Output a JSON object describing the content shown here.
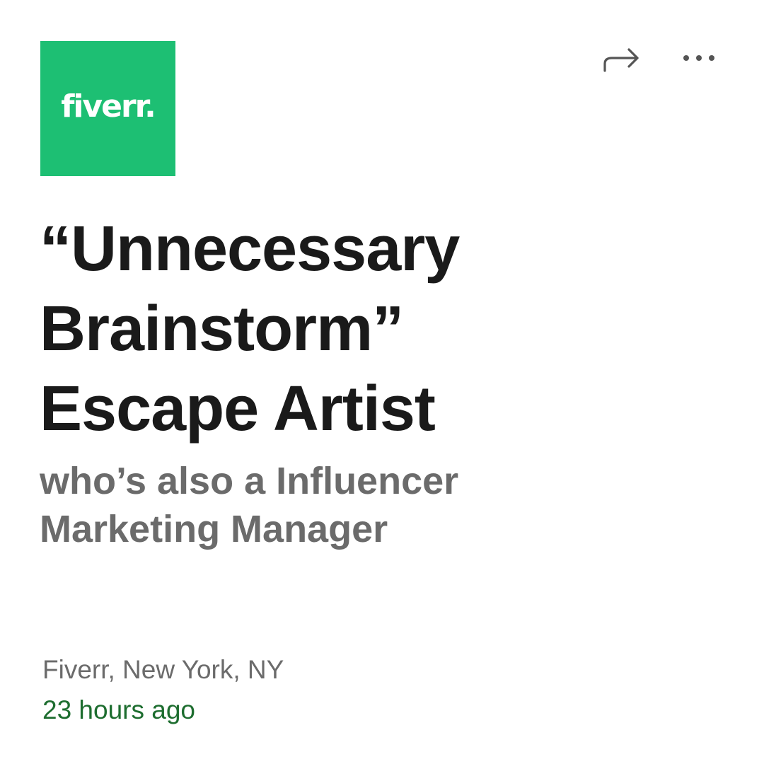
{
  "logo": {
    "text": "fiverr.",
    "color": "#1dbf73"
  },
  "actions": {
    "share_icon": "share-arrow-icon",
    "more_icon": "more-dots-icon"
  },
  "job": {
    "title_lines": [
      "“Unnecessary",
      "Brainstorm”",
      "Escape Artist"
    ],
    "subtitle_lines": [
      "who’s also a Influencer",
      "Marketing Manager"
    ],
    "location": "Fiverr, New York, NY",
    "posted": "23 hours ago"
  },
  "colors": {
    "title": "#1a1a1a",
    "subtitle": "#6b6b6b",
    "posted": "#1d6d2f"
  }
}
